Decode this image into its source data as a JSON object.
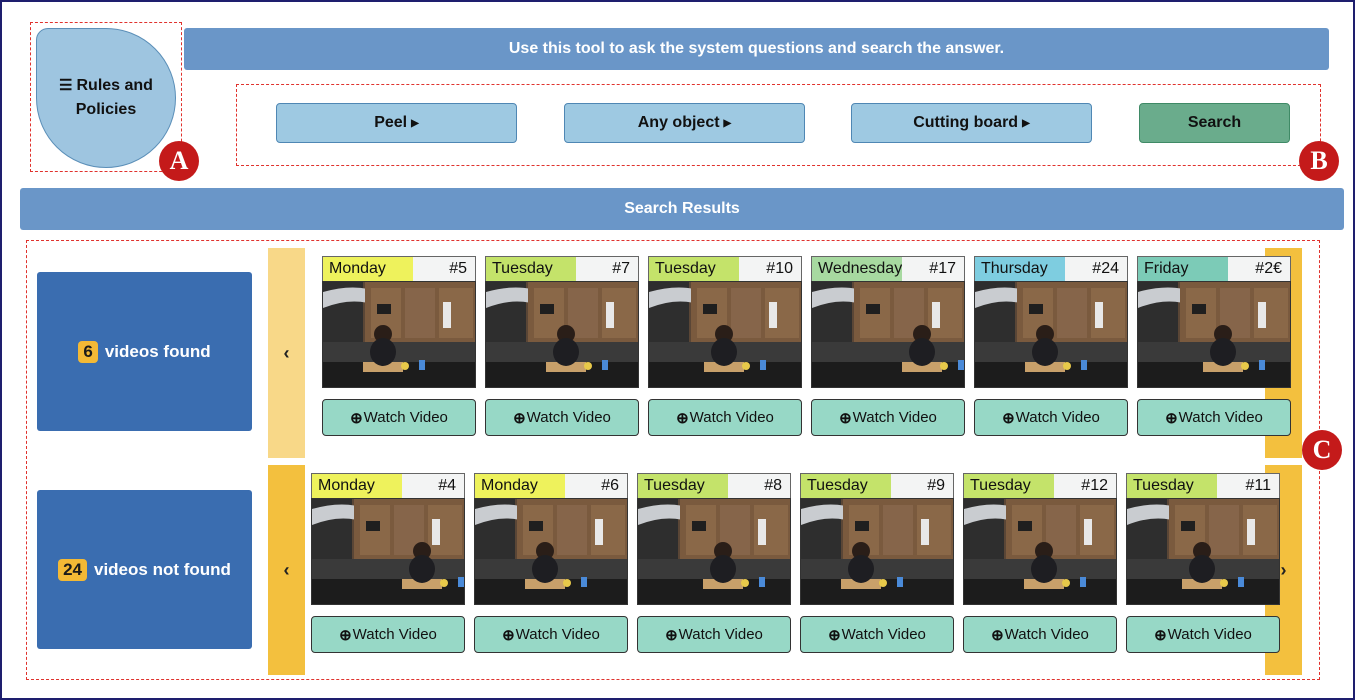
{
  "rules_button": {
    "label_line1": "Rules and",
    "label_line2": "Policies",
    "icon": "list-icon"
  },
  "header_banner": "Use this tool to ask the system questions and search the answer.",
  "query": {
    "chips": [
      "Peel",
      "Any object",
      "Cutting board"
    ],
    "search_label": "Search"
  },
  "results_banner": "Search Results",
  "markers": {
    "a": "A",
    "b": "B",
    "c": "C"
  },
  "found": {
    "count": "6",
    "label": "videos found",
    "videos": [
      {
        "day": "Monday",
        "num": "#5",
        "color": "#eef25c"
      },
      {
        "day": "Tuesday",
        "num": "#7",
        "color": "#c4e36a"
      },
      {
        "day": "Tuesday",
        "num": "#10",
        "color": "#c4e36a"
      },
      {
        "day": "Wednesday",
        "num": "#17",
        "color": "#a7d9a0"
      },
      {
        "day": "Thursday",
        "num": "#24",
        "color": "#7ecde0"
      },
      {
        "day": "Friday",
        "num": "#2€",
        "color": "#7ccbb7"
      }
    ]
  },
  "not_found": {
    "count": "24",
    "label": "videos not found",
    "videos": [
      {
        "day": "Monday",
        "num": "#4",
        "color": "#eef25c"
      },
      {
        "day": "Monday",
        "num": "#6",
        "color": "#eef25c"
      },
      {
        "day": "Tuesday",
        "num": "#8",
        "color": "#c4e36a"
      },
      {
        "day": "Tuesday",
        "num": "#9",
        "color": "#c4e36a"
      },
      {
        "day": "Tuesday",
        "num": "#12",
        "color": "#c4e36a"
      },
      {
        "day": "Tuesday",
        "num": "#11",
        "color": "#c4e36a"
      }
    ]
  },
  "watch_label": "Watch Video",
  "nav": {
    "prev": "‹",
    "next": "›"
  },
  "colors": {
    "nav_found_prev": "#f8d888",
    "nav_found_next": "#f3c03e",
    "nav_notfound": "#f3c03e"
  }
}
